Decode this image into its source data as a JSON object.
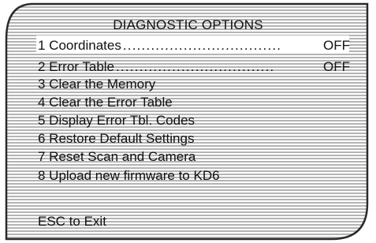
{
  "menu": {
    "title": "DIAGNOSTIC OPTIONS",
    "items": [
      {
        "label": "1 Coordinates",
        "dots": "..................................",
        "value": "OFF",
        "selected": true
      },
      {
        "label": "2 Error Table",
        "dots": "..................................",
        "value": "OFF",
        "selected": false
      },
      {
        "label": "3 Clear the Memory",
        "dots": "",
        "value": "",
        "selected": false
      },
      {
        "label": "4 Clear the Error Table",
        "dots": "",
        "value": "",
        "selected": false
      },
      {
        "label": "5 Display Error Tbl. Codes",
        "dots": "",
        "value": "",
        "selected": false
      },
      {
        "label": "6 Restore Default Settings",
        "dots": "",
        "value": "",
        "selected": false
      },
      {
        "label": "7 Reset Scan and Camera",
        "dots": "",
        "value": "",
        "selected": false
      },
      {
        "label": "8 Upload new firmware to KD6",
        "dots": "",
        "value": "",
        "selected": false
      }
    ],
    "exit_label": "ESC to Exit"
  },
  "colors": {
    "background": "#ffffff",
    "scanline": "#b4b4b4",
    "frame": "#2a2a2a",
    "text": "#111111",
    "selection": "#ffffff"
  }
}
